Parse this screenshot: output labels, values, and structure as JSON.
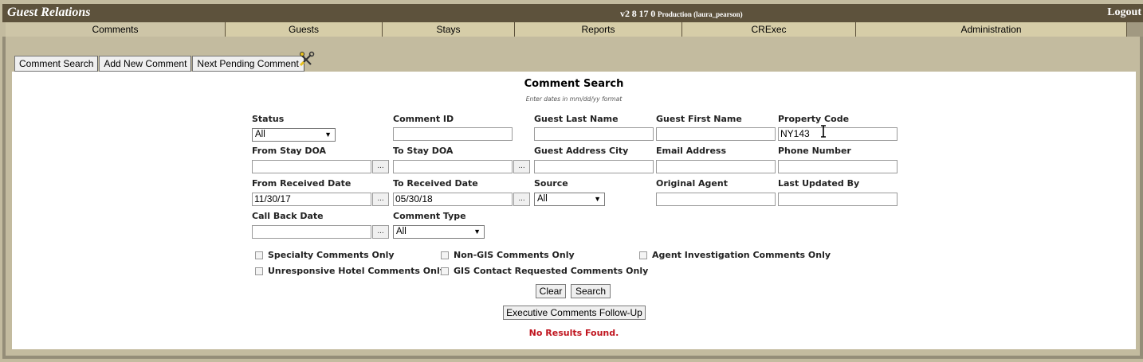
{
  "app": {
    "title": "Guest Relations",
    "version_parts": [
      "v2",
      "8",
      "17",
      "0"
    ],
    "environment": "Production (laura_pearson)",
    "logout_label": "Logout"
  },
  "tabs": [
    {
      "label": "Comments",
      "active": true
    },
    {
      "label": "Guests"
    },
    {
      "label": "Stays"
    },
    {
      "label": "Reports"
    },
    {
      "label": "CRExec"
    },
    {
      "label": "Administration"
    }
  ],
  "toolbar": {
    "comment_search": "Comment Search",
    "add_new_comment": "Add New Comment",
    "next_pending_comment": "Next Pending Comment",
    "tools_icon": "scissors-tools-icon"
  },
  "form": {
    "title": "Comment Search",
    "hint": "Enter dates in mm/dd/yy format",
    "status_label": "Status",
    "status_value": "All",
    "comment_id_label": "Comment ID",
    "comment_id_value": "",
    "guest_last_name_label": "Guest Last Name",
    "guest_last_name_value": "",
    "guest_first_name_label": "Guest First Name",
    "guest_first_name_value": "",
    "property_code_label": "Property Code",
    "property_code_value": "NY143",
    "from_stay_doa_label": "From Stay DOA",
    "from_stay_doa_value": "",
    "to_stay_doa_label": "To Stay DOA",
    "to_stay_doa_value": "",
    "guest_address_city_label": "Guest Address City",
    "guest_address_city_value": "",
    "email_address_label": "Email Address",
    "email_address_value": "",
    "phone_number_label": "Phone Number",
    "phone_number_value": "",
    "from_received_date_label": "From Received Date",
    "from_received_date_value": "11/30/17",
    "to_received_date_label": "To Received Date",
    "to_received_date_value": "05/30/18",
    "source_label": "Source",
    "source_value": "All",
    "original_agent_label": "Original Agent",
    "original_agent_value": "",
    "last_updated_by_label": "Last Updated By",
    "last_updated_by_value": "",
    "call_back_date_label": "Call Back Date",
    "call_back_date_value": "",
    "comment_type_label": "Comment Type",
    "comment_type_value": "All",
    "date_picker_label": "...",
    "checkboxes": {
      "specialty": "Specialty Comments Only",
      "non_gis": "Non-GIS Comments Only",
      "agent_investigation": "Agent Investigation Comments Only",
      "unresponsive_hotel": "Unresponsive Hotel Comments Only",
      "gis_contact": "GIS Contact Requested Comments Only"
    },
    "clear_label": "Clear",
    "search_label": "Search",
    "executive_label": "Executive Comments Follow-Up",
    "no_results": "No Results Found.",
    "dropdown_arrow": "▼"
  }
}
